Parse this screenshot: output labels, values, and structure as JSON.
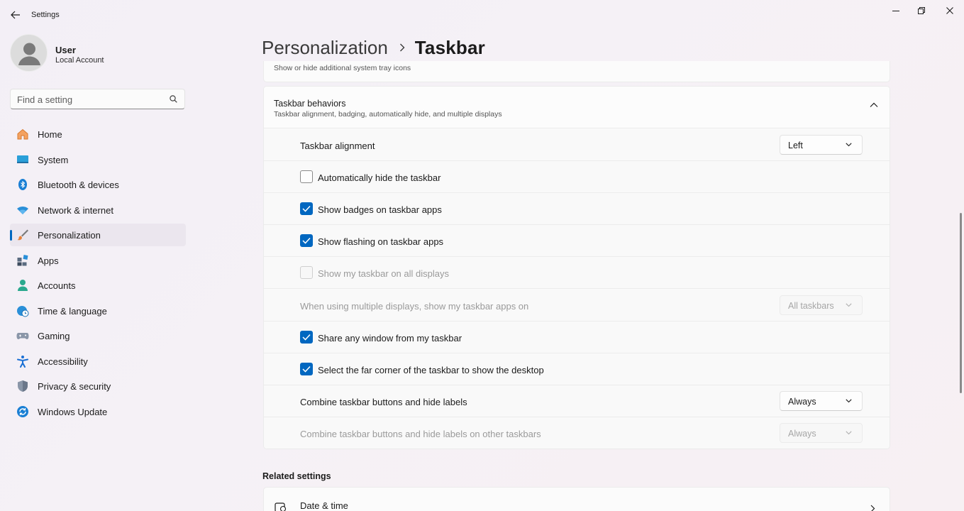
{
  "window": {
    "title": "Settings"
  },
  "user": {
    "name": "User",
    "account_type": "Local Account"
  },
  "search": {
    "placeholder": "Find a setting"
  },
  "sidebar": {
    "items": [
      {
        "label": "Home",
        "icon": "home-icon"
      },
      {
        "label": "System",
        "icon": "system-icon"
      },
      {
        "label": "Bluetooth & devices",
        "icon": "bluetooth-icon"
      },
      {
        "label": "Network & internet",
        "icon": "wifi-icon"
      },
      {
        "label": "Personalization",
        "icon": "brush-icon",
        "active": true
      },
      {
        "label": "Apps",
        "icon": "apps-icon"
      },
      {
        "label": "Accounts",
        "icon": "person-icon"
      },
      {
        "label": "Time & language",
        "icon": "globe-clock-icon"
      },
      {
        "label": "Gaming",
        "icon": "gamepad-icon"
      },
      {
        "label": "Accessibility",
        "icon": "accessibility-icon"
      },
      {
        "label": "Privacy & security",
        "icon": "shield-icon"
      },
      {
        "label": "Windows Update",
        "icon": "update-icon"
      }
    ]
  },
  "breadcrumb": {
    "parent": "Personalization",
    "current": "Taskbar"
  },
  "top_card": {
    "description": "Show or hide additional system tray icons"
  },
  "behaviors": {
    "title": "Taskbar behaviors",
    "subtitle": "Taskbar alignment, badging, automatically hide, and multiple displays",
    "rows": [
      {
        "type": "dropdown",
        "label": "Taskbar alignment",
        "value": "Left",
        "enabled": true
      },
      {
        "type": "checkbox",
        "label": "Automatically hide the taskbar",
        "checked": false,
        "enabled": true
      },
      {
        "type": "checkbox",
        "label": "Show badges on taskbar apps",
        "checked": true,
        "enabled": true
      },
      {
        "type": "checkbox",
        "label": "Show flashing on taskbar apps",
        "checked": true,
        "enabled": true
      },
      {
        "type": "checkbox",
        "label": "Show my taskbar on all displays",
        "checked": false,
        "enabled": false
      },
      {
        "type": "dropdown",
        "label": "When using multiple displays, show my taskbar apps on",
        "value": "All taskbars",
        "enabled": false
      },
      {
        "type": "checkbox",
        "label": "Share any window from my taskbar",
        "checked": true,
        "enabled": true
      },
      {
        "type": "checkbox",
        "label": "Select the far corner of the taskbar to show the desktop",
        "checked": true,
        "enabled": true
      },
      {
        "type": "dropdown",
        "label": "Combine taskbar buttons and hide labels",
        "value": "Always",
        "enabled": true
      },
      {
        "type": "dropdown",
        "label": "Combine taskbar buttons and hide labels on other taskbars",
        "value": "Always",
        "enabled": false
      }
    ]
  },
  "related": {
    "title": "Related settings",
    "items": [
      {
        "label": "Date & time"
      }
    ]
  },
  "colors": {
    "accent": "#0067c0",
    "disabled_text": "#9a9a9a"
  }
}
